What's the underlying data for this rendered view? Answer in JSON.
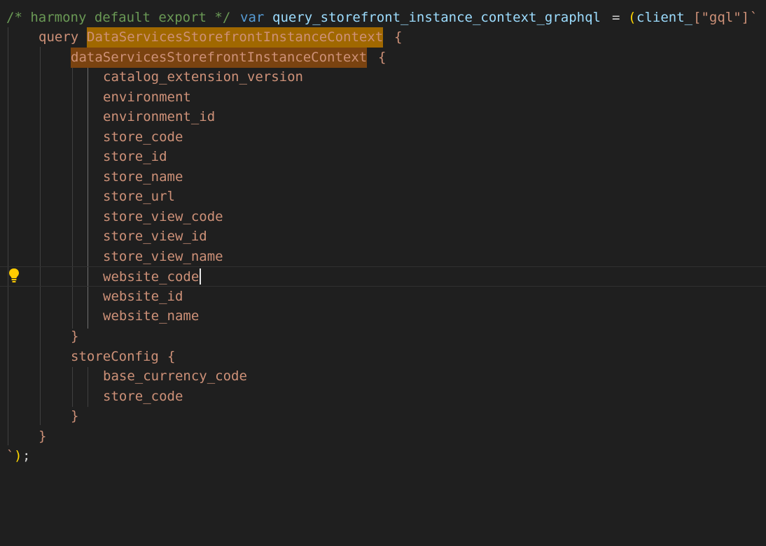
{
  "editor": {
    "line1": {
      "comment": "/* harmony default export */",
      "keyword": "var",
      "identifier": "query_storefront_instance_context_graphql",
      "equals": "=",
      "paren_open": "(",
      "callee": "client_",
      "index": "[\"gql\"]",
      "backtick": "`"
    },
    "query_keyword": "query",
    "operation_name": "DataServicesStorefrontInstanceContext",
    "brace_open": "{",
    "brace_close": "}",
    "context_field": "dataServicesStorefrontInstanceContext",
    "context_subfields": [
      "catalog_extension_version",
      "environment",
      "environment_id",
      "store_code",
      "store_id",
      "store_name",
      "store_url",
      "store_view_code",
      "store_view_id",
      "store_view_name",
      "website_code",
      "website_id",
      "website_name"
    ],
    "store_config_field": "storeConfig",
    "store_config_subfields": [
      "base_currency_code",
      "store_code"
    ],
    "closing": {
      "backtick": "`",
      "paren_close": ")",
      "semicolon": ";"
    },
    "lightbulb_icon": "lightbulb-icon",
    "colors": {
      "background": "#1f1f1f",
      "comment": "#6a9955",
      "keyword": "#569cd6",
      "variable": "#9cdcfe",
      "string": "#ce9178",
      "paren": "#ffd700",
      "highlight_name": "#a06800",
      "highlight_context": "#7a4310"
    }
  }
}
